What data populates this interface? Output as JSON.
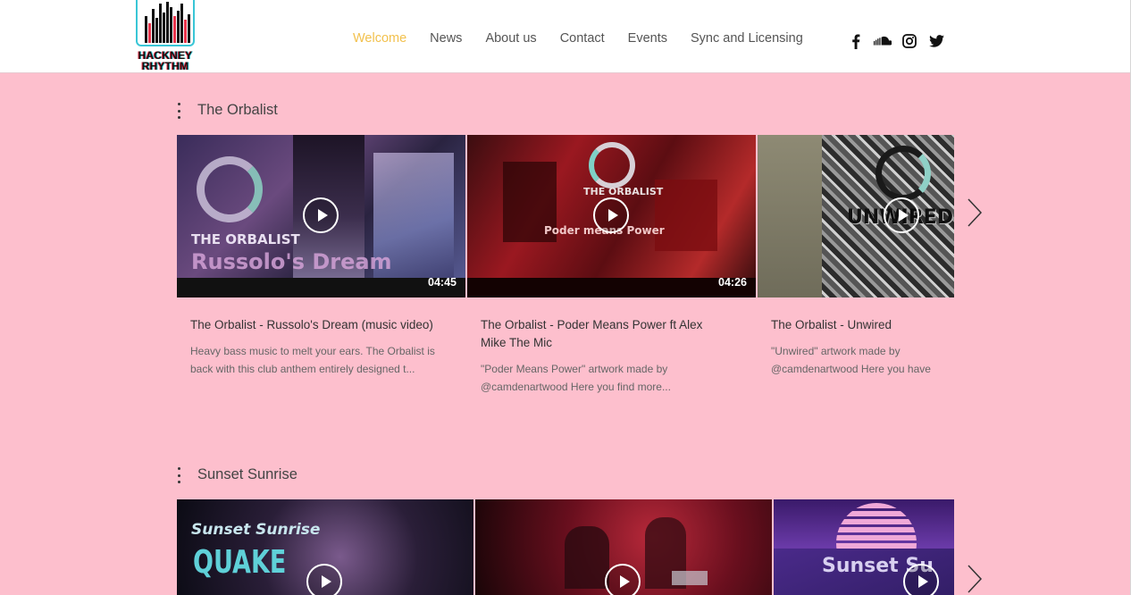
{
  "header": {
    "logo": {
      "line1": "HACKNEY",
      "line2": "RHYTHM"
    },
    "nav": [
      {
        "label": "Welcome",
        "active": true
      },
      {
        "label": "News",
        "active": false
      },
      {
        "label": "About us",
        "active": false
      },
      {
        "label": "Contact",
        "active": false
      },
      {
        "label": "Events",
        "active": false
      },
      {
        "label": "Sync and Licensing",
        "active": false
      }
    ],
    "social": [
      "facebook-icon",
      "soundcloud-icon",
      "instagram-icon",
      "twitter-icon"
    ],
    "accent_color": "#f2c14e"
  },
  "page_background": "#fdbfcd",
  "channels": [
    {
      "title": "The Orbalist",
      "videos": [
        {
          "title": "The Orbalist - Russolo's Dream (music video)",
          "description": "Heavy bass music to melt your ears. The Orbalist is back with this club anthem entirely designed t...",
          "duration": "04:45",
          "overlay_brand": "THE ORBALIST",
          "overlay_title": "Russolo's Dream"
        },
        {
          "title": "The Orbalist - Poder Means Power ft Alex Mike The Mic",
          "description": "\"Poder Means Power\" artwork made by @camdenartwood Here you find more...",
          "duration": "04:26",
          "overlay_brand": "THE ORBALIST",
          "overlay_title": "Poder means Power"
        },
        {
          "title": "The Orbalist - Unwired",
          "description": "\"Unwired\" artwork made by @camdenartwood Here you have more...",
          "duration": "",
          "overlay_brand": "",
          "overlay_title": "UNWIRED"
        }
      ]
    },
    {
      "title": "Sunset Sunrise",
      "videos": [
        {
          "overlay_brand": "Sunset Sunrise",
          "overlay_title": "QUAKE"
        },
        {
          "overlay_brand": "",
          "overlay_title": ""
        },
        {
          "overlay_brand": "",
          "overlay_title": "Sunset Su"
        }
      ]
    }
  ]
}
